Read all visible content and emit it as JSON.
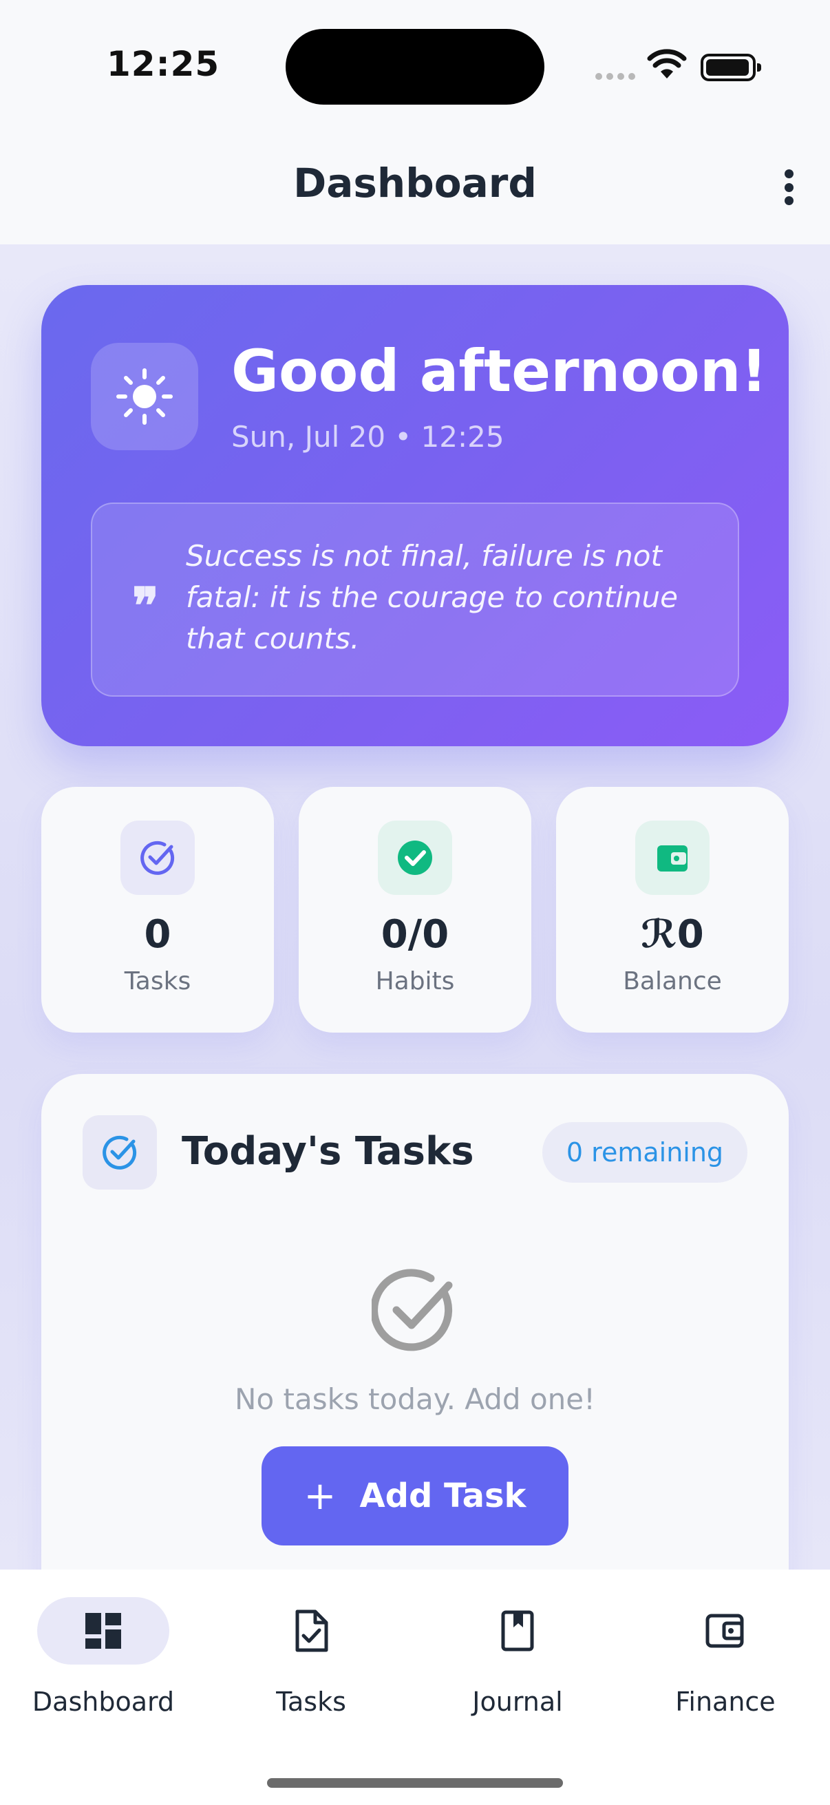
{
  "status_bar": {
    "time": "12:25"
  },
  "app_bar": {
    "title": "Dashboard"
  },
  "hero": {
    "greeting": "Good afternoon!",
    "datetime": "Sun, Jul 20 • 12:25",
    "quote": "Success is not final, failure is not fatal: it is the courage to continue that counts.",
    "quote_mark": "❞"
  },
  "stats": [
    {
      "value": "0",
      "label": "Tasks",
      "icon": "check-circle-icon",
      "color": "#6366f1"
    },
    {
      "value": "0/0",
      "label": "Habits",
      "icon": "check-filled-icon",
      "color": "#10b981"
    },
    {
      "value": "ℛ0",
      "label": "Balance",
      "icon": "wallet-icon",
      "color": "#10b981"
    }
  ],
  "tasks_card": {
    "title": "Today's Tasks",
    "remaining": "0 remaining",
    "empty_text": "No tasks today. Add one!",
    "add_plus": "+",
    "add_label": "Add Task"
  },
  "bottom_nav": [
    {
      "label": "Dashboard",
      "icon": "dashboard-icon",
      "active": true
    },
    {
      "label": "Tasks",
      "icon": "task-file-icon",
      "active": false
    },
    {
      "label": "Journal",
      "icon": "journal-icon",
      "active": false
    },
    {
      "label": "Finance",
      "icon": "wallet-icon",
      "active": false
    }
  ],
  "colors": {
    "accent": "#6366f1",
    "green": "#10b981",
    "blue": "#2b93e6"
  }
}
